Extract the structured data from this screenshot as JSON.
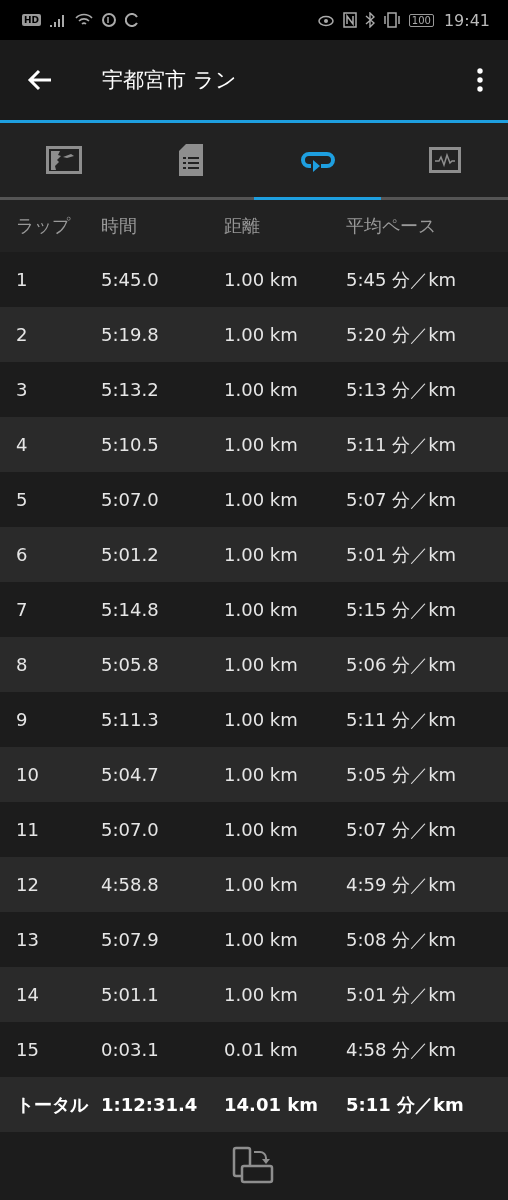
{
  "status_bar": {
    "hd_badge": "HD",
    "battery": "100",
    "time": "19:41"
  },
  "app_bar": {
    "title": "宇都宮市 ラン"
  },
  "tabs": [
    {
      "kind": "map",
      "selected": false
    },
    {
      "kind": "details",
      "selected": false
    },
    {
      "kind": "laps",
      "selected": true
    },
    {
      "kind": "chart",
      "selected": false
    }
  ],
  "table": {
    "columns": [
      "ラップ",
      "時間",
      "距離",
      "平均ペース"
    ],
    "rows": [
      [
        "1",
        "5:45.0",
        "1.00 km",
        "5:45 分／km"
      ],
      [
        "2",
        "5:19.8",
        "1.00 km",
        "5:20 分／km"
      ],
      [
        "3",
        "5:13.2",
        "1.00 km",
        "5:13 分／km"
      ],
      [
        "4",
        "5:10.5",
        "1.00 km",
        "5:11 分／km"
      ],
      [
        "5",
        "5:07.0",
        "1.00 km",
        "5:07 分／km"
      ],
      [
        "6",
        "5:01.2",
        "1.00 km",
        "5:01 分／km"
      ],
      [
        "7",
        "5:14.8",
        "1.00 km",
        "5:15 分／km"
      ],
      [
        "8",
        "5:05.8",
        "1.00 km",
        "5:06 分／km"
      ],
      [
        "9",
        "5:11.3",
        "1.00 km",
        "5:11 分／km"
      ],
      [
        "10",
        "5:04.7",
        "1.00 km",
        "5:05 分／km"
      ],
      [
        "11",
        "5:07.0",
        "1.00 km",
        "5:07 分／km"
      ],
      [
        "12",
        "4:58.8",
        "1.00 km",
        "4:59 分／km"
      ],
      [
        "13",
        "5:07.9",
        "1.00 km",
        "5:08 分／km"
      ],
      [
        "14",
        "5:01.1",
        "1.00 km",
        "5:01 分／km"
      ],
      [
        "15",
        "0:03.1",
        "0.01 km",
        "4:58 分／km"
      ]
    ],
    "total": [
      "トータル",
      "1:12:31.4",
      "14.01 km",
      "5:11 分／km"
    ]
  }
}
